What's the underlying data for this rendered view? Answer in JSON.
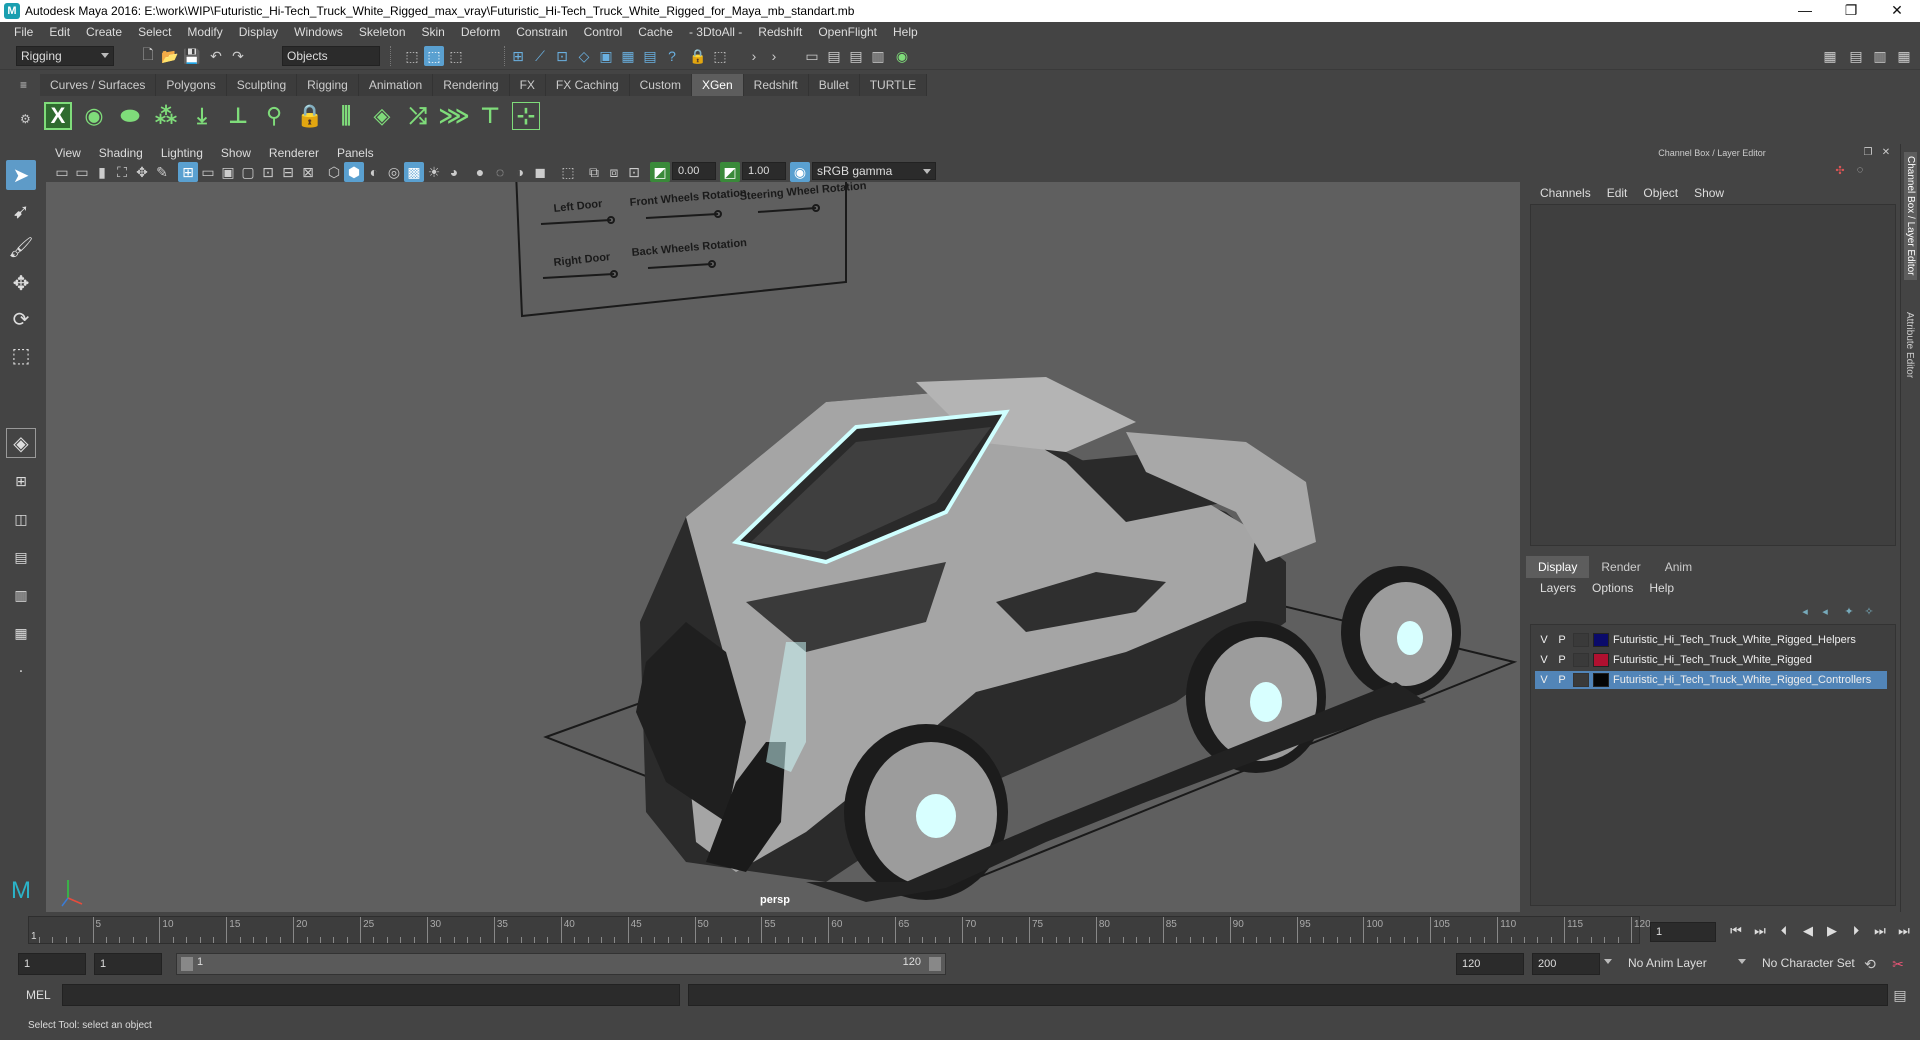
{
  "window": {
    "title": "Autodesk Maya 2016: E:\\work\\WIP\\Futuristic_Hi-Tech_Truck_White_Rigged_max_vray\\Futuristic_Hi-Tech_Truck_White_Rigged_for_Maya_mb_standart.mb",
    "minimize": "—",
    "restore": "❐",
    "close": "✕"
  },
  "menubar": [
    "File",
    "Edit",
    "Create",
    "Select",
    "Modify",
    "Display",
    "Windows",
    "Skeleton",
    "Skin",
    "Deform",
    "Constrain",
    "Control",
    "Cache",
    "- 3DtoAll -",
    "Redshift",
    "OpenFlight",
    "Help"
  ],
  "statusline": {
    "mode": "Rigging",
    "select_mode": "Objects"
  },
  "shelf": {
    "tabs": [
      "Curves / Surfaces",
      "Polygons",
      "Sculpting",
      "Rigging",
      "Animation",
      "Rendering",
      "FX",
      "FX Caching",
      "Custom",
      "XGen",
      "Redshift",
      "Bullet",
      "TURTLE"
    ],
    "active_tab": "XGen",
    "icons": [
      "xgen-icon",
      "preview-eye-icon",
      "primitive-icon",
      "add-guide-icon",
      "sculpt-guide-icon",
      "insert-point-icon",
      "lock-guide-icon",
      "lock-icon",
      "comb-icon",
      "layer-stack-icon",
      "grab-icon",
      "groom-icon",
      "guide-icon",
      "select-guide-icon"
    ]
  },
  "viewport": {
    "menu": [
      "View",
      "Shading",
      "Lighting",
      "Show",
      "Renderer",
      "Panels"
    ],
    "exposure": "0.00",
    "gamma": "1.00",
    "color_space": "sRGB gamma",
    "camera_label": "persp",
    "rig_panel_labels": [
      "Left Door",
      "Front Wheels Rotation",
      "Steering Wheel Rotation",
      "Right Door",
      "Back Wheels Rotation"
    ]
  },
  "channel_box": {
    "title": "Channel Box / Layer Editor",
    "menu": [
      "Channels",
      "Edit",
      "Object",
      "Show"
    ]
  },
  "layer_editor": {
    "tabs": [
      "Display",
      "Render",
      "Anim"
    ],
    "active_tab": "Display",
    "menu": [
      "Layers",
      "Options",
      "Help"
    ],
    "layers": [
      {
        "v": "V",
        "p": "P",
        "name": "Futuristic_Hi_Tech_Truck_White_Rigged_Helpers",
        "color": "#0a0a6a",
        "selected": false
      },
      {
        "v": "V",
        "p": "P",
        "name": "Futuristic_Hi_Tech_Truck_White_Rigged",
        "color": "#b01030",
        "selected": false
      },
      {
        "v": "V",
        "p": "P",
        "name": "Futuristic_Hi_Tech_Truck_White_Rigged_Controllers",
        "color": "#050505",
        "selected": true
      }
    ]
  },
  "side_tabs": [
    "Channel Box / Layer Editor",
    "Attribute Editor"
  ],
  "timeline": {
    "start": "1",
    "ticks": [
      "5",
      "10",
      "15",
      "20",
      "25",
      "30",
      "35",
      "40",
      "45",
      "50",
      "55",
      "60",
      "65",
      "70",
      "75",
      "80",
      "85",
      "90",
      "95",
      "100",
      "105",
      "110",
      "115",
      "120"
    ],
    "current_frame": "1"
  },
  "range": {
    "start": "1",
    "playback_start": "1",
    "slider_start": "1",
    "slider_end": "120",
    "playback_end": "120",
    "end": "200",
    "anim_layer": "No Anim Layer",
    "character_set": "No Character Set"
  },
  "command_line": {
    "label": "MEL"
  },
  "help_line": {
    "text": "Select Tool: select an object"
  }
}
